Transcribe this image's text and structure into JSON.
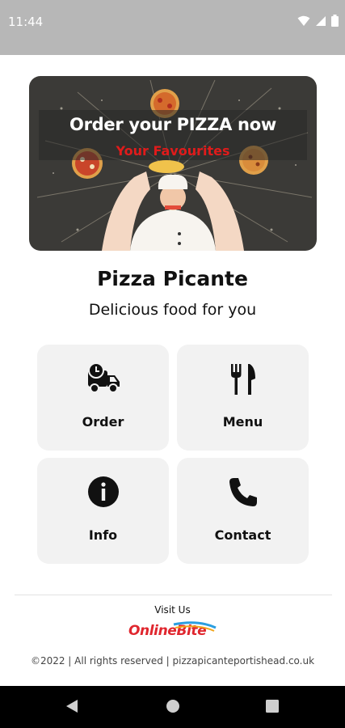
{
  "status_bar": {
    "time": "11:44",
    "icons": [
      "wifi-icon",
      "signal-icon",
      "battery-icon"
    ]
  },
  "banner": {
    "title": "Order your PIZZA now",
    "subtitle": "Your Favourites"
  },
  "app": {
    "name": "Pizza Picante",
    "tagline": "Delicious food for you"
  },
  "tiles": [
    {
      "label": "Order",
      "icon": "delivery-truck-icon"
    },
    {
      "label": "Menu",
      "icon": "fork-knife-icon"
    },
    {
      "label": "Info",
      "icon": "info-icon"
    },
    {
      "label": "Contact",
      "icon": "phone-icon"
    }
  ],
  "footer": {
    "visit_label": "Visit Us",
    "logo_text": "OnlineBite",
    "copyright": "©2022 | All rights reserved | pizzapicanteportishead.co.uk"
  },
  "nav_bar": {
    "buttons": [
      "back-icon",
      "home-icon",
      "recents-icon"
    ]
  },
  "colors": {
    "status_bar": "#b7b7b7",
    "tile_bg": "#f2f2f2",
    "banner_subtitle": "#e01b1b",
    "logo": "#e0262e",
    "nav_bar": "#000000"
  }
}
